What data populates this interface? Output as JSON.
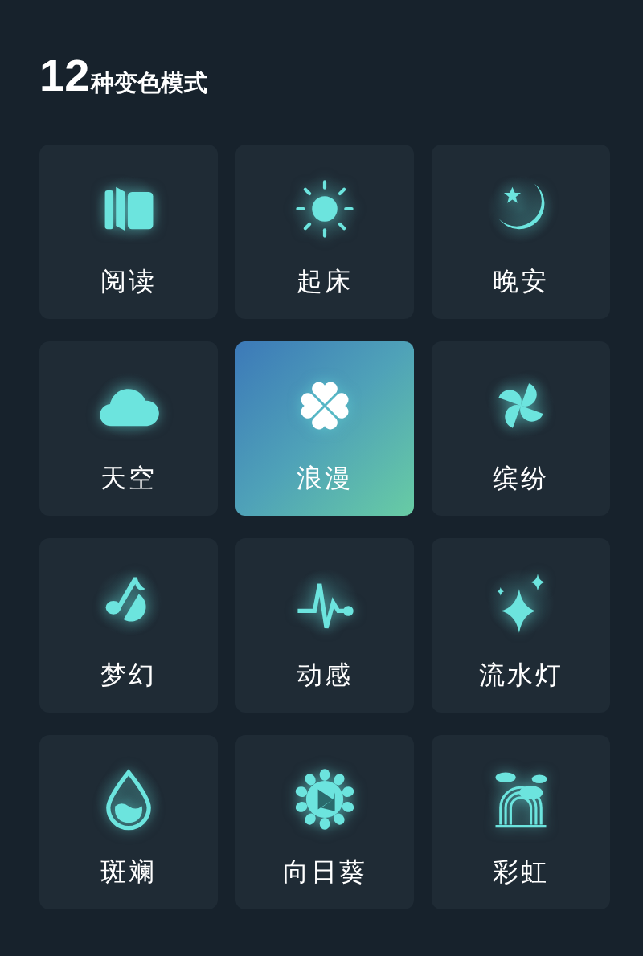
{
  "header": {
    "count": "12",
    "title": "种变色模式"
  },
  "modes": [
    {
      "label": "阅读",
      "selected": false
    },
    {
      "label": "起床",
      "selected": false
    },
    {
      "label": "晚安",
      "selected": false
    },
    {
      "label": "天空",
      "selected": false
    },
    {
      "label": "浪漫",
      "selected": true
    },
    {
      "label": "缤纷",
      "selected": false
    },
    {
      "label": "梦幻",
      "selected": false
    },
    {
      "label": "动感",
      "selected": false
    },
    {
      "label": "流水灯",
      "selected": false
    },
    {
      "label": "斑斓",
      "selected": false
    },
    {
      "label": "向日葵",
      "selected": false
    },
    {
      "label": "彩虹",
      "selected": false
    }
  ]
}
